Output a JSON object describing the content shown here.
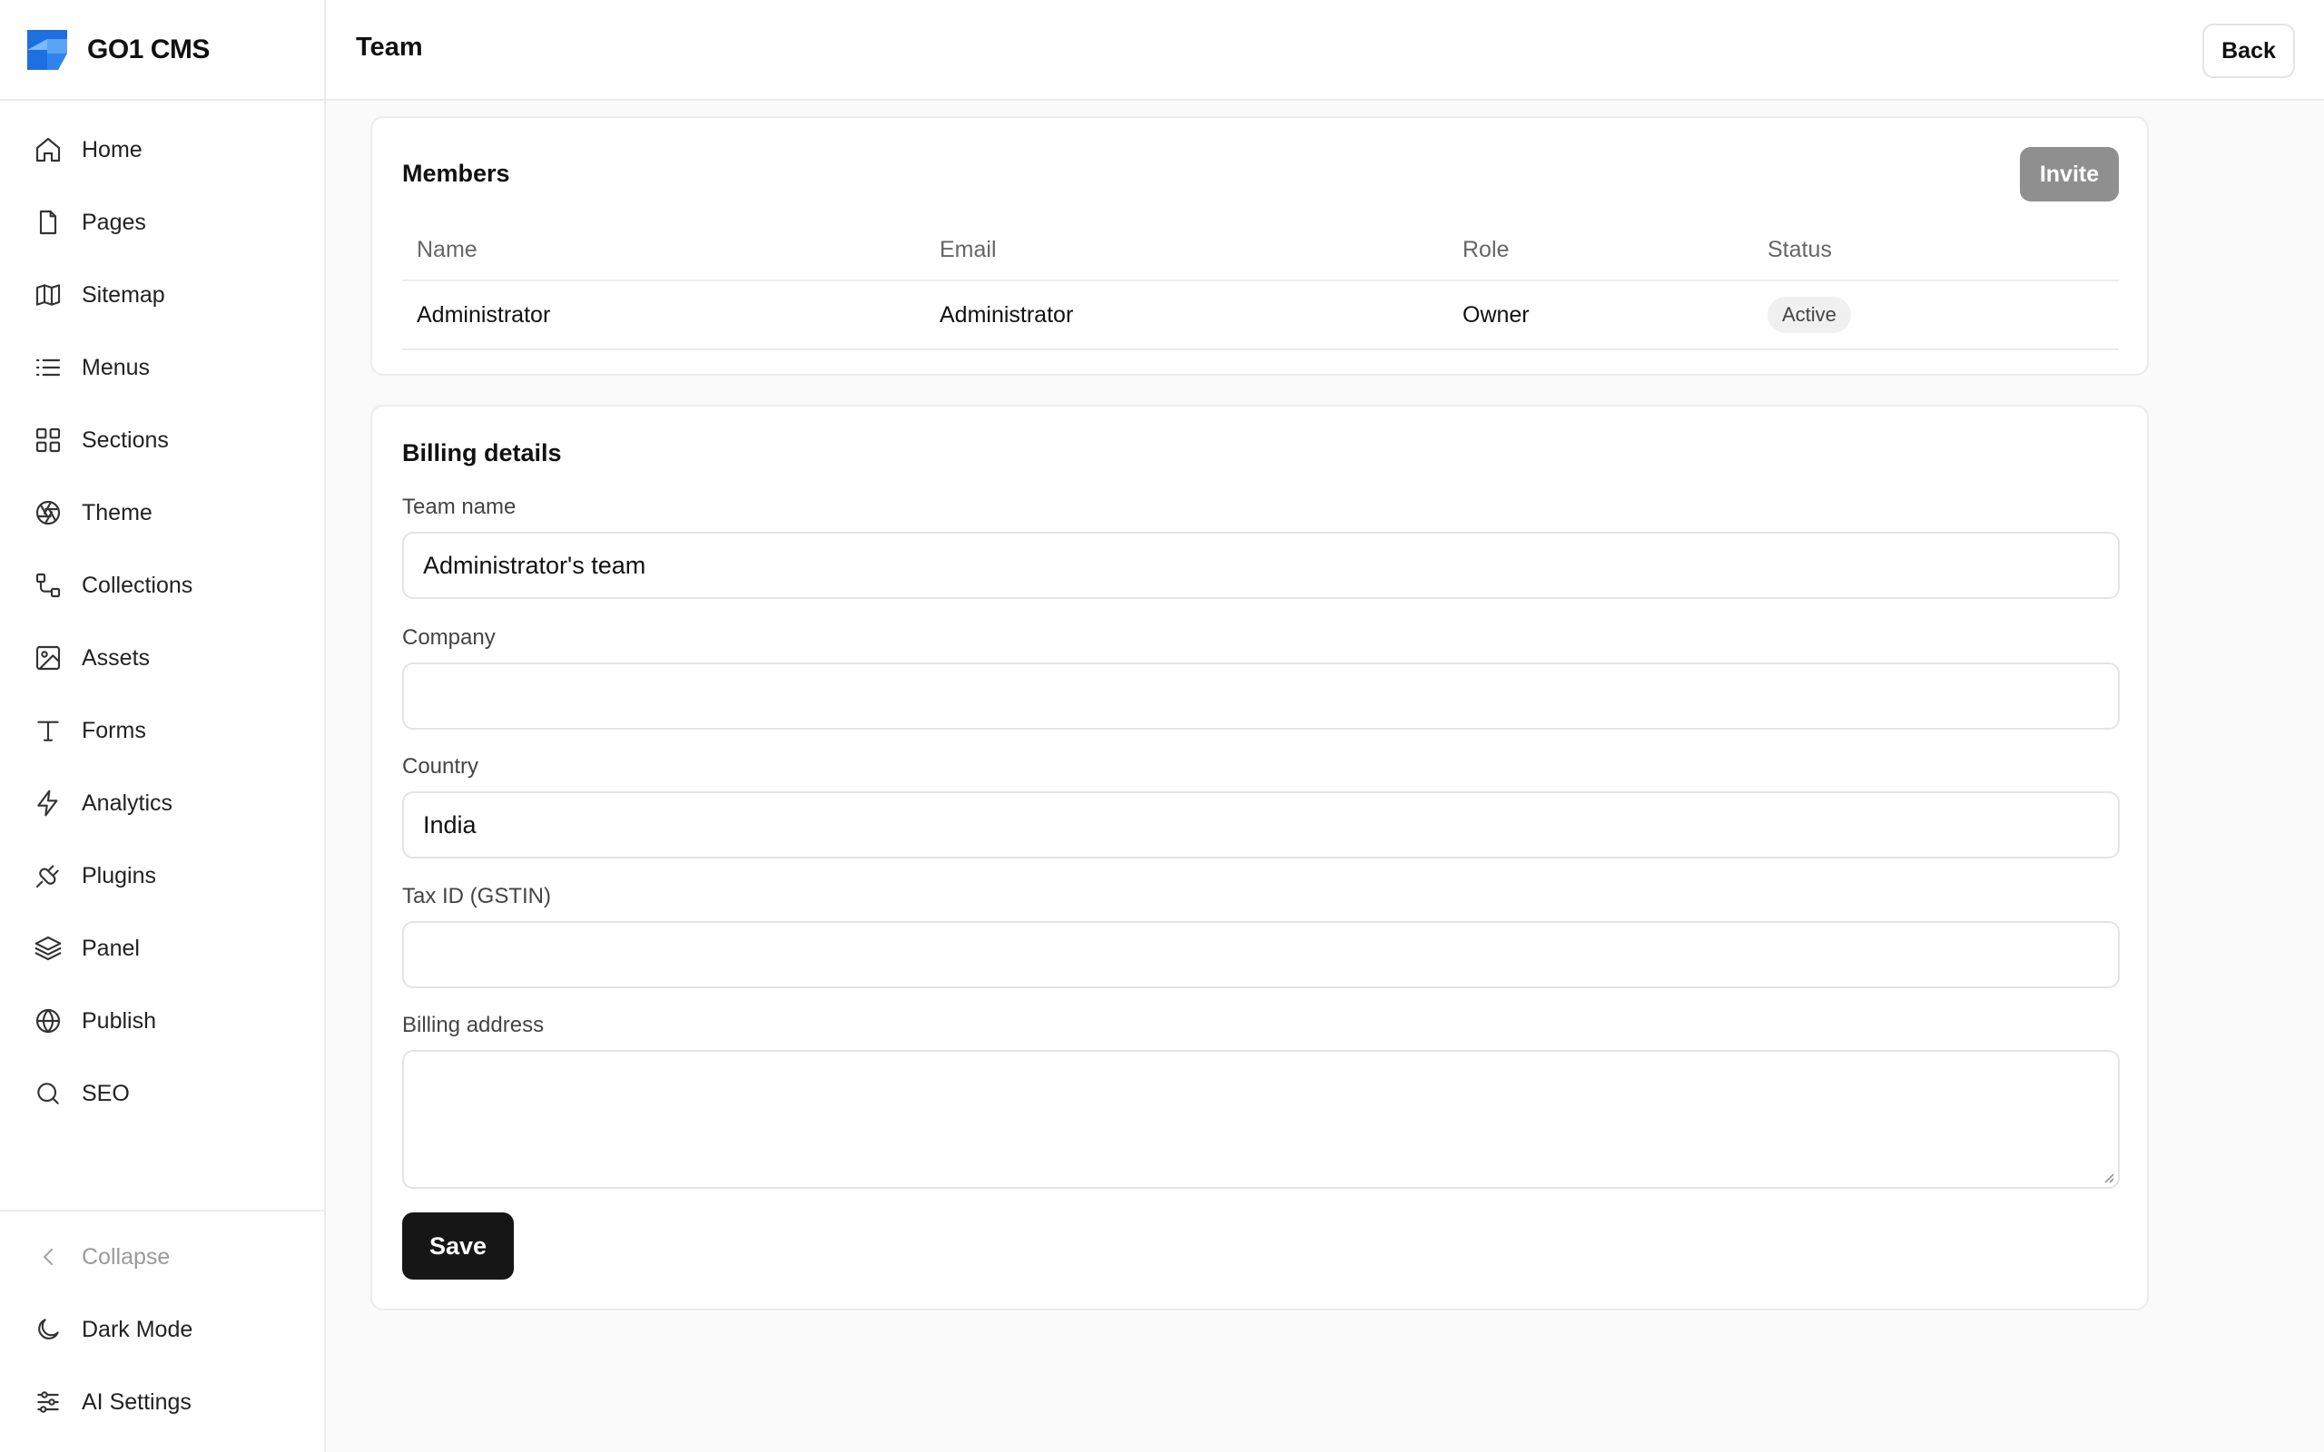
{
  "brand": {
    "name": "GO1 CMS"
  },
  "sidebar": {
    "items": [
      {
        "label": "Home",
        "icon": "home-icon"
      },
      {
        "label": "Pages",
        "icon": "file-icon"
      },
      {
        "label": "Sitemap",
        "icon": "map-icon"
      },
      {
        "label": "Menus",
        "icon": "list-icon"
      },
      {
        "label": "Sections",
        "icon": "grid-icon"
      },
      {
        "label": "Theme",
        "icon": "aperture-icon"
      },
      {
        "label": "Collections",
        "icon": "workflow-icon"
      },
      {
        "label": "Assets",
        "icon": "image-icon"
      },
      {
        "label": "Forms",
        "icon": "type-icon"
      },
      {
        "label": "Analytics",
        "icon": "zap-icon"
      },
      {
        "label": "Plugins",
        "icon": "plug-icon"
      },
      {
        "label": "Panel",
        "icon": "layers-icon"
      },
      {
        "label": "Publish",
        "icon": "globe-icon"
      },
      {
        "label": "SEO",
        "icon": "search-icon"
      }
    ],
    "bottom": [
      {
        "label": "Collapse",
        "icon": "chevron-left-icon"
      },
      {
        "label": "Dark Mode",
        "icon": "moon-icon"
      },
      {
        "label": "AI Settings",
        "icon": "sliders-icon"
      }
    ]
  },
  "header": {
    "title": "Team",
    "back_label": "Back"
  },
  "members": {
    "title": "Members",
    "invite_label": "Invite",
    "columns": [
      "Name",
      "Email",
      "Role",
      "Status"
    ],
    "rows": [
      {
        "name": "Administrator",
        "email": "Administrator",
        "role": "Owner",
        "status": "Active"
      }
    ]
  },
  "billing": {
    "title": "Billing details",
    "team_name": {
      "label": "Team name",
      "value": "Administrator's team"
    },
    "company": {
      "label": "Company",
      "value": ""
    },
    "country": {
      "label": "Country",
      "value": "India"
    },
    "tax_id": {
      "label": "Tax ID (GSTIN)",
      "value": ""
    },
    "billing_address": {
      "label": "Billing address",
      "value": ""
    },
    "save_label": "Save"
  },
  "colors": {
    "logo_primary": "#1e6fe0",
    "logo_secondary": "#5aa3f5",
    "invite_button": "#8f8f8f",
    "save_button": "#161616"
  }
}
